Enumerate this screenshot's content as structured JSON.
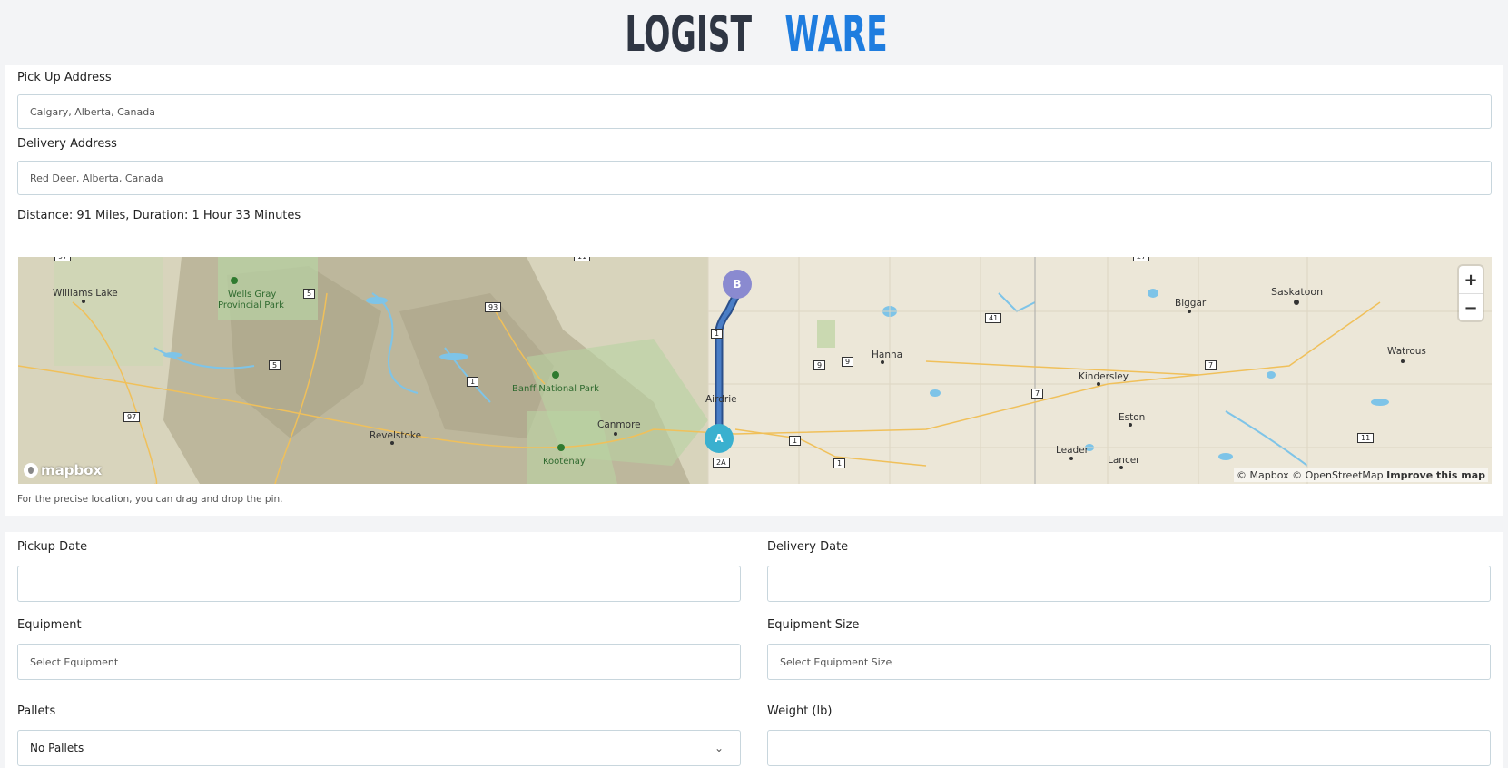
{
  "logo": {
    "part1": "LOGIST",
    "part2": "WARE"
  },
  "form": {
    "pickup_label": "Pick Up Address",
    "pickup_value": "Calgary, Alberta, Canada",
    "delivery_label": "Delivery Address",
    "delivery_value": "Red Deer, Alberta, Canada",
    "distance_text": "Distance: 91 Miles, Duration: 1 Hour 33 Minutes",
    "hint": "For the precise location, you can drag and drop the pin."
  },
  "map": {
    "marker_a": "A",
    "marker_b": "B",
    "zoom_in": "+",
    "zoom_out": "−",
    "logo_text": "mapbox",
    "attribution": "© Mapbox © OpenStreetMap",
    "improve": "Improve this map",
    "places": {
      "williams_lake": "Williams Lake",
      "wells_gray": "Wells Gray",
      "wells_gray_2": "Provincial Park",
      "banff": "Banff National Park",
      "revelstoke": "Revelstoke",
      "canmore": "Canmore",
      "kootenay": "Kootenay",
      "airdrie": "Airdrie",
      "hanna": "Hanna",
      "kindersley": "Kindersley",
      "eston": "Eston",
      "leader": "Leader",
      "lancer": "Lancer",
      "biggar": "Biggar",
      "saskatoon": "Saskatoon",
      "watrous": "Watrous"
    },
    "shields": [
      "97",
      "11",
      "5",
      "93",
      "5",
      "1",
      "97",
      "1",
      "2A",
      "9",
      "9",
      "41",
      "7",
      "7",
      "1",
      "11",
      "27",
      "2"
    ],
    "colors": {
      "route": "#3a6fb0",
      "marker_a": "#3ab0cf",
      "marker_b": "#8a8ad0"
    }
  },
  "details": {
    "pickup_date_label": "Pickup Date",
    "delivery_date_label": "Delivery Date",
    "equipment_label": "Equipment",
    "equipment_placeholder": "Select Equipment",
    "equipment_size_label": "Equipment Size",
    "equipment_size_placeholder": "Select Equipment Size",
    "pallets_label": "Pallets",
    "pallets_value": "No Pallets",
    "weight_label": "Weight (lb)"
  }
}
